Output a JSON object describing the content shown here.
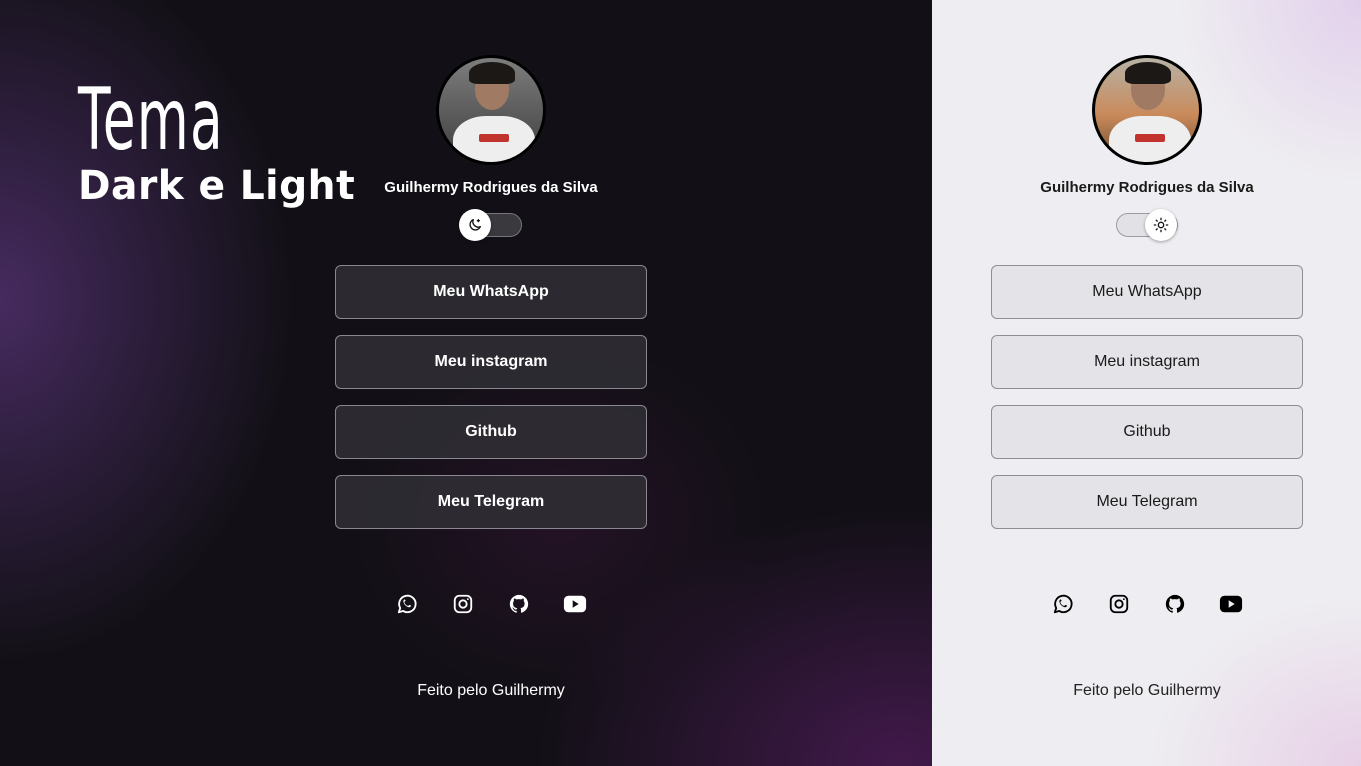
{
  "headline": {
    "title": "Tema",
    "subtitle": "Dark e Light"
  },
  "colors": {
    "dark_background": "#121016",
    "dark_accent": "#583478",
    "light_background": "#eeedf1",
    "light_accent": "#e1cdeb"
  },
  "dark_theme": {
    "profile_name": "Guilhermy Rodrigues da Silva",
    "toggle": {
      "state": "dark",
      "icon": "moon-icon"
    },
    "links": [
      {
        "label": "Meu WhatsApp"
      },
      {
        "label": "Meu instagram"
      },
      {
        "label": "Github"
      },
      {
        "label": "Meu Telegram"
      }
    ],
    "socials": [
      "whatsapp-icon",
      "instagram-icon",
      "github-icon",
      "youtube-icon"
    ],
    "footer": "Feito pelo Guilhermy"
  },
  "light_theme": {
    "profile_name": "Guilhermy Rodrigues da Silva",
    "toggle": {
      "state": "light",
      "icon": "sun-icon"
    },
    "links": [
      {
        "label": "Meu WhatsApp"
      },
      {
        "label": "Meu instagram"
      },
      {
        "label": "Github"
      },
      {
        "label": "Meu Telegram"
      }
    ],
    "socials": [
      "whatsapp-icon",
      "instagram-icon",
      "github-icon",
      "youtube-icon"
    ],
    "footer": "Feito pelo Guilhermy"
  }
}
